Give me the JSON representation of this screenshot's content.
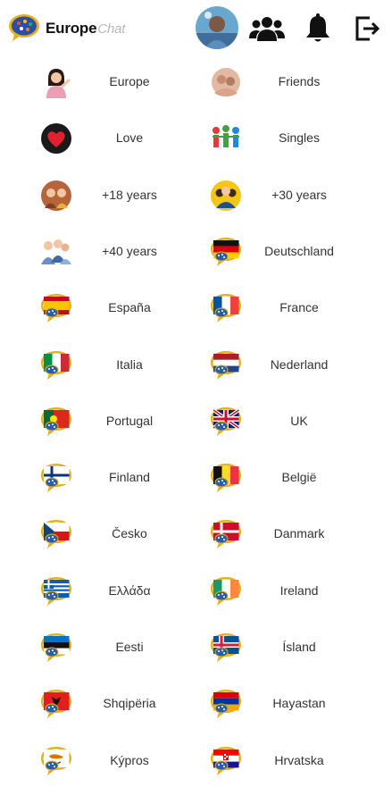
{
  "header": {
    "brand_main": "Europe",
    "brand_light": "Chat",
    "icons": [
      "app-logo-icon",
      "profile-avatar",
      "friends-group-icon",
      "bell-icon",
      "logout-icon"
    ]
  },
  "rooms": [
    {
      "label": "Europe",
      "icon": "woman-icon"
    },
    {
      "label": "Friends",
      "icon": "friends-avatar-icon"
    },
    {
      "label": "Love",
      "icon": "heart-icon"
    },
    {
      "label": "Singles",
      "icon": "singles-icon"
    },
    {
      "label": "+18 years",
      "icon": "young-couple-icon"
    },
    {
      "label": "+30 years",
      "icon": "adult-group-icon"
    },
    {
      "label": "+40 years",
      "icon": "senior-group-icon"
    },
    {
      "label": "Deutschland",
      "icon": "flag-de-icon"
    },
    {
      "label": "España",
      "icon": "flag-es-icon"
    },
    {
      "label": "France",
      "icon": "flag-fr-icon"
    },
    {
      "label": "Italia",
      "icon": "flag-it-icon"
    },
    {
      "label": "Nederland",
      "icon": "flag-nl-icon"
    },
    {
      "label": "Portugal",
      "icon": "flag-pt-icon"
    },
    {
      "label": "UK",
      "icon": "flag-uk-icon"
    },
    {
      "label": "Finland",
      "icon": "flag-fi-icon"
    },
    {
      "label": "België",
      "icon": "flag-be-icon"
    },
    {
      "label": "Česko",
      "icon": "flag-cz-icon"
    },
    {
      "label": "Danmark",
      "icon": "flag-dk-icon"
    },
    {
      "label": "Ελλάδα",
      "icon": "flag-gr-icon"
    },
    {
      "label": "Ireland",
      "icon": "flag-ie-icon"
    },
    {
      "label": "Eesti",
      "icon": "flag-ee-icon"
    },
    {
      "label": "Ísland",
      "icon": "flag-is-icon"
    },
    {
      "label": "Shqipëria",
      "icon": "flag-al-icon"
    },
    {
      "label": "Hayastan",
      "icon": "flag-am-icon"
    },
    {
      "label": "Kýpros",
      "icon": "flag-cy-icon"
    },
    {
      "label": "Hrvatska",
      "icon": "flag-hr-icon"
    }
  ]
}
